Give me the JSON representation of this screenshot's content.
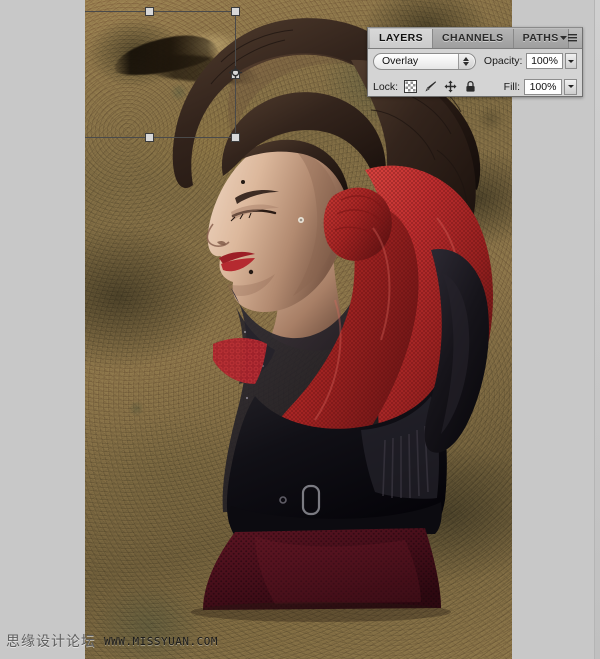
{
  "app": {
    "canvas_background_color": "#c8c8c8",
    "document_texture_name": "grunge-wall-texture"
  },
  "panel": {
    "tabs": [
      {
        "label": "LAYERS",
        "active": true
      },
      {
        "label": "CHANNELS",
        "active": false
      },
      {
        "label": "PATHS",
        "active": false
      }
    ],
    "menu_icon": "panel-menu-icon",
    "blend_mode": {
      "value": "Overlay",
      "stepper_icon": "stepper-arrows-icon"
    },
    "opacity": {
      "label": "Opacity:",
      "value": "100%",
      "arrow_icon": "chevron-down-icon"
    },
    "lock": {
      "label": "Lock:",
      "icons": [
        {
          "name": "lock-transparent-pixels-icon"
        },
        {
          "name": "lock-image-pixels-brush-icon"
        },
        {
          "name": "lock-position-move-icon"
        },
        {
          "name": "lock-all-padlock-icon"
        }
      ]
    },
    "fill": {
      "label": "Fill:",
      "value": "100%",
      "arrow_icon": "chevron-down-icon"
    }
  },
  "transform": {
    "name": "free-transform-bounding-box",
    "handles": [
      "top-left",
      "top-center",
      "top-right",
      "middle-left",
      "middle-right",
      "bottom-left",
      "bottom-center",
      "bottom-right"
    ],
    "origin_icon": "transform-reference-point-icon"
  },
  "watermark": {
    "site_name_cn": "思缘设计论坛",
    "url": "WWW.MISSYUAN.COM"
  },
  "artwork": {
    "description": "woman-portrait-red-mesh-gloves",
    "colors": {
      "red_mesh": "#b4262a",
      "dark_red_skirt": "#50101c",
      "black_sheer_top": "#17161a",
      "hair": "#3a2a22",
      "skin": "#d7b49c",
      "lips": "#9c2026",
      "background_wall": "#8a7349"
    }
  }
}
